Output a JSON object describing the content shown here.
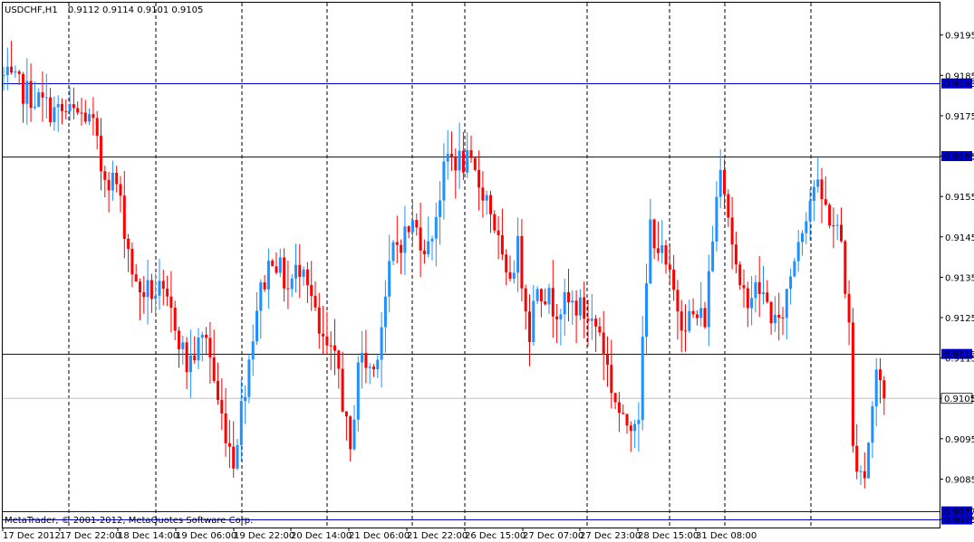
{
  "chart_data": {
    "type": "candlestick",
    "symbol_header": "USDCHF,H1",
    "ohlc_header": "0.9112 0.9114 0.9101 0.9105",
    "footer_text": "MetaTrader, © 2001-2012, MetaQuotes Software Corp.",
    "y_range": [
      0.9073,
      0.9203
    ],
    "y_ticks": [
      "0.9195",
      "0.9185",
      "0.9175",
      "0.9165",
      "0.9155",
      "0.9145",
      "0.9135",
      "0.9125",
      "0.9115",
      "0.9105",
      "0.9095",
      "0.9085",
      "0.9075"
    ],
    "x_labels": [
      "17 Dec 2012",
      "17 Dec 22:00",
      "18 Dec 14:00",
      "19 Dec 06:00",
      "19 Dec 22:00",
      "20 Dec 14:00",
      "21 Dec 06:00",
      "21 Dec 22:00",
      "26 Dec 15:00",
      "27 Dec 07:00",
      "27 Dec 23:00",
      "28 Dec 15:00",
      "31 Dec 08:00"
    ],
    "horizontal_levels": [
      {
        "price": 0.9183,
        "label": "0.9183"
      },
      {
        "price": 0.9165,
        "label": "0.9165"
      },
      {
        "price": 0.9116,
        "label": "0.9116"
      },
      {
        "price": 0.9077,
        "label": "0.9077"
      },
      {
        "price": 0.9075,
        "label": "0.9075"
      }
    ],
    "bid_line": {
      "price": 0.9105,
      "label": "0.9105"
    },
    "colors": {
      "bull": "#1e90ff",
      "bear": "#ff0000",
      "level": "#0000cd",
      "bid": "#c0c0c0",
      "grid": "#000000"
    },
    "grid": "vertical dashed",
    "candle_count": 191,
    "waypoints": [
      [
        0,
        0.9185
      ],
      [
        8,
        0.918
      ],
      [
        14,
        0.9176
      ],
      [
        22,
        0.9175
      ],
      [
        24,
        0.9172
      ],
      [
        26,
        0.9162
      ],
      [
        30,
        0.9158
      ],
      [
        35,
        0.9132
      ],
      [
        41,
        0.9131
      ],
      [
        45,
        0.9124
      ],
      [
        48,
        0.9113
      ],
      [
        53,
        0.9121
      ],
      [
        56,
        0.9104
      ],
      [
        60,
        0.909
      ],
      [
        64,
        0.9115
      ],
      [
        66,
        0.9128
      ],
      [
        70,
        0.9141
      ],
      [
        74,
        0.9132
      ],
      [
        78,
        0.914
      ],
      [
        82,
        0.912
      ],
      [
        87,
        0.9112
      ],
      [
        90,
        0.909
      ],
      [
        92,
        0.9115
      ],
      [
        96,
        0.9112
      ],
      [
        101,
        0.9142
      ],
      [
        106,
        0.9148
      ],
      [
        110,
        0.9142
      ],
      [
        115,
        0.9165
      ],
      [
        120,
        0.9163
      ],
      [
        125,
        0.9155
      ],
      [
        127,
        0.9148
      ],
      [
        130,
        0.9133
      ],
      [
        133,
        0.9142
      ],
      [
        136,
        0.9122
      ],
      [
        138,
        0.9134
      ],
      [
        142,
        0.9128
      ],
      [
        148,
        0.9128
      ],
      [
        154,
        0.9122
      ],
      [
        157,
        0.9108
      ],
      [
        160,
        0.9098
      ],
      [
        164,
        0.9102
      ],
      [
        167,
        0.9148
      ],
      [
        170,
        0.914
      ],
      [
        175,
        0.9125
      ],
      [
        181,
        0.9125
      ],
      [
        185,
        0.9165
      ],
      [
        190,
        0.913
      ],
      [
        195,
        0.9132
      ],
      [
        200,
        0.9122
      ],
      [
        205,
        0.9145
      ],
      [
        209,
        0.9158
      ],
      [
        213,
        0.915
      ],
      [
        216,
        0.9144
      ],
      [
        218,
        0.9122
      ],
      [
        219,
        0.9092
      ],
      [
        222,
        0.9086
      ],
      [
        225,
        0.9112
      ],
      [
        227,
        0.9105
      ]
    ]
  }
}
